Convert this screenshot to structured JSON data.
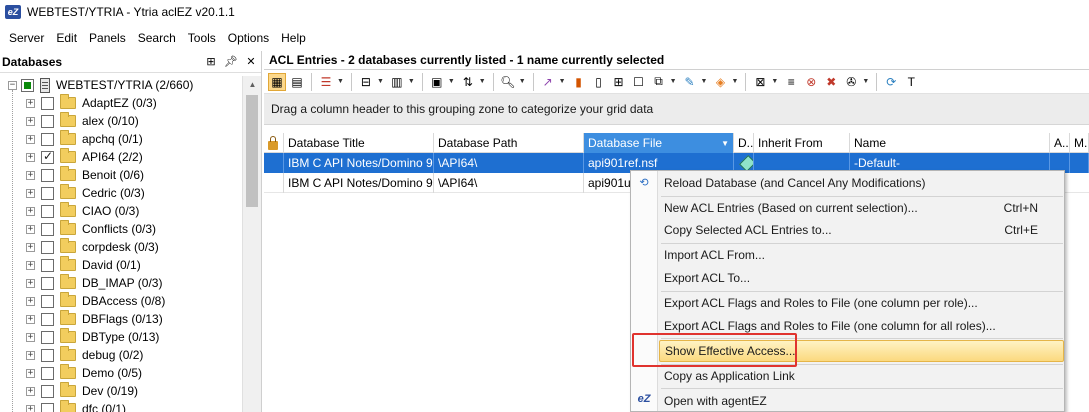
{
  "window": {
    "title": "WEBTEST/YTRIA - Ytria aclEZ v20.1.1",
    "app_icon": "aclez-app-icon"
  },
  "menu": {
    "items": [
      "Server",
      "Edit",
      "Panels",
      "Search",
      "Tools",
      "Options",
      "Help"
    ]
  },
  "databases_panel": {
    "title": "Databases",
    "controls": [
      "grid-icon",
      "pin-icon",
      "close-icon"
    ],
    "root": {
      "label": "WEBTEST/YTRIA  (2/660)",
      "expander": "−"
    },
    "items": [
      {
        "label": "AdaptEZ  (0/3)",
        "checked": false
      },
      {
        "label": "alex  (0/10)",
        "checked": false
      },
      {
        "label": "apchq  (0/1)",
        "checked": false
      },
      {
        "label": "API64  (2/2)",
        "checked": true
      },
      {
        "label": "Benoit  (0/6)",
        "checked": false
      },
      {
        "label": "Cedric  (0/3)",
        "checked": false
      },
      {
        "label": "CIAO  (0/3)",
        "checked": false
      },
      {
        "label": "Conflicts  (0/3)",
        "checked": false
      },
      {
        "label": "corpdesk  (0/3)",
        "checked": false
      },
      {
        "label": "David  (0/1)",
        "checked": false
      },
      {
        "label": "DB_IMAP  (0/3)",
        "checked": false
      },
      {
        "label": "DBAccess  (0/8)",
        "checked": false
      },
      {
        "label": "DBFlags  (0/13)",
        "checked": false
      },
      {
        "label": "DBType  (0/13)",
        "checked": false
      },
      {
        "label": "debug  (0/2)",
        "checked": false
      },
      {
        "label": "Demo  (0/5)",
        "checked": false
      },
      {
        "label": "Dev  (0/19)",
        "checked": false
      },
      {
        "label": "dfc  (0/1)",
        "checked": false
      }
    ]
  },
  "acl_panel": {
    "title": "ACL Entries - 2 databases currently listed - 1 name currently selected",
    "group_zone_text": "Drag a column header to this grouping zone to categorize your grid data",
    "columns": [
      "Database Title",
      "Database Path",
      "Database File",
      "D..",
      "Inherit From",
      "Name",
      "A..",
      "M."
    ],
    "rows": [
      {
        "title": "IBM C API Notes/Domino 9",
        "path": "\\API64\\",
        "file": "api901ref.nsf",
        "name": "-Default-",
        "selected": true
      },
      {
        "title": "IBM C API Notes/Domino 9",
        "path": "\\API64\\",
        "file": "api901u",
        "name": "",
        "selected": false
      }
    ]
  },
  "context_menu": {
    "items": [
      {
        "label": "Reload Database (and Cancel Any Modifications)",
        "shortcut": "",
        "icon": "reload-icon"
      },
      {
        "label": "New ACL Entries (Based on current selection)...",
        "shortcut": "Ctrl+N",
        "icon": ""
      },
      {
        "label": "Copy Selected ACL Entries to...",
        "shortcut": "Ctrl+E",
        "icon": ""
      },
      {
        "label": "Import ACL From...",
        "shortcut": "",
        "icon": ""
      },
      {
        "label": "Export ACL To...",
        "shortcut": "",
        "icon": ""
      },
      {
        "label": "Export ACL Flags and Roles to File (one column per role)...",
        "shortcut": "",
        "icon": ""
      },
      {
        "label": "Export ACL Flags and Roles to File (one column for all roles)...",
        "shortcut": "",
        "icon": ""
      },
      {
        "label": "Show Effective Access...",
        "shortcut": "",
        "icon": "",
        "highlighted": true
      },
      {
        "label": "Copy as Application Link",
        "shortcut": "",
        "icon": ""
      },
      {
        "label": "Open with agentEZ",
        "shortcut": "",
        "icon": "agentez-icon"
      }
    ]
  },
  "colors": {
    "selection": "#1e6fd1",
    "sorted_header": "#3d8ee0",
    "menu_highlight": "#fbd97f",
    "annotation_red": "#e0332e"
  }
}
